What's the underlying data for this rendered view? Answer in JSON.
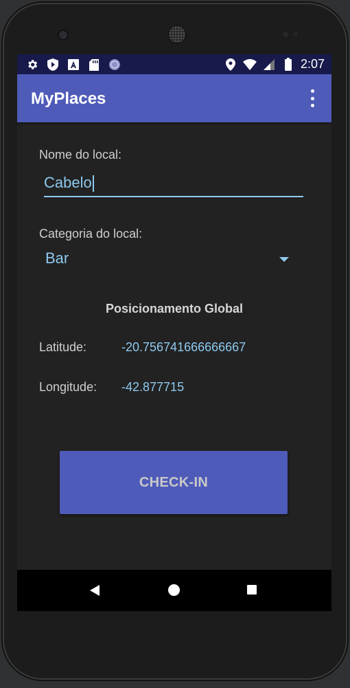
{
  "status_bar": {
    "time": "2:07",
    "icons_left": [
      "settings-icon",
      "shield-icon",
      "a-icon",
      "sd-card-icon",
      "sync-icon"
    ],
    "icons_right": [
      "location-icon",
      "wifi-icon",
      "signal-icon",
      "battery-icon"
    ]
  },
  "app_bar": {
    "title": "MyPlaces",
    "overflow_icon": "more-vert-icon"
  },
  "form": {
    "place_name_label": "Nome do local:",
    "place_name_value": "Cabelo",
    "category_label": "Categoria do local:",
    "category_value": "Bar"
  },
  "gps": {
    "title": "Posicionamento Global",
    "latitude_label": "Latitude:",
    "latitude_value": "-20.756741666666667",
    "longitude_label": "Longitude:",
    "longitude_value": "-42.877715"
  },
  "checkin_button": "CHECK-IN",
  "colors": {
    "primary": "#4f5bb9",
    "status_bar": "#171a4a",
    "accent_text": "#8ec9ef",
    "background": "#222222"
  }
}
